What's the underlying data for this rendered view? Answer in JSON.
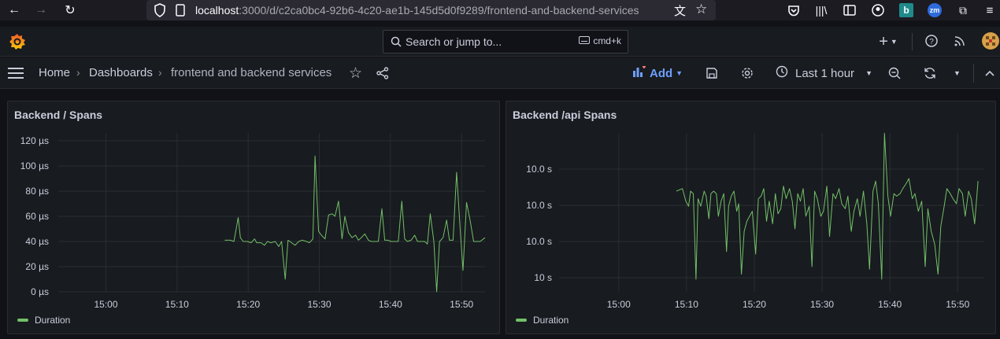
{
  "browser": {
    "url_host": "localhost",
    "url_rest": ":3000/d/c2ca0bc4-92b6-4c20-ae1b-145d5d0f9289/frontend-and-backend-services"
  },
  "topnav": {
    "search_placeholder": "Search or jump to...",
    "shortcut": "cmd+k",
    "add_label": "+"
  },
  "breadcrumb": {
    "home": "Home",
    "dashboards": "Dashboards",
    "current": "frontend and backend services"
  },
  "toolbar": {
    "add_label": "Add",
    "time_range": "Last 1 hour"
  },
  "colors": {
    "series": "#73bf69",
    "accent": "#6e9fff"
  },
  "chart_data": [
    {
      "type": "line",
      "title": "Backend / Spans",
      "xlabel": "",
      "ylabel": "",
      "y_ticks": [
        "0 µs",
        "20 µs",
        "40 µs",
        "60 µs",
        "80 µs",
        "100 µs",
        "120 µs"
      ],
      "ylim": [
        0,
        120
      ],
      "x_ticks": [
        "15:00",
        "15:10",
        "15:20",
        "15:30",
        "15:40",
        "15:50"
      ],
      "xlim_minutes": [
        53.3,
        113.3
      ],
      "legend": "bottom-left",
      "series": [
        {
          "name": "Duration",
          "x_minutes": [
            76.7,
            77.5,
            78.0,
            78.6,
            78.9,
            79.3,
            79.9,
            80.4,
            80.9,
            81.2,
            81.8,
            82.3,
            82.7,
            83.2,
            83.8,
            84.3,
            84.7,
            85.2,
            85.6,
            86.1,
            86.6,
            87.1,
            87.6,
            88.2,
            88.6,
            89.1,
            89.4,
            89.9,
            90.3,
            90.8,
            91.3,
            91.8,
            92.2,
            92.7,
            93.2,
            93.6,
            94.1,
            94.6,
            95.1,
            95.5,
            95.9,
            96.4,
            96.9,
            97.3,
            97.9,
            98.3,
            98.8,
            99.2,
            99.6,
            100.1,
            100.6,
            101.1,
            101.6,
            102.0,
            102.4,
            102.9,
            103.4,
            103.8,
            104.3,
            104.8,
            105.2,
            105.6,
            106.1,
            106.5,
            106.9,
            107.4,
            107.9,
            108.3,
            108.8,
            109.3,
            109.8,
            110.2,
            110.7,
            111.2,
            111.7,
            112.1,
            112.6,
            113.3
          ],
          "values": [
            41,
            41,
            40,
            59,
            43,
            40,
            40,
            39,
            42,
            39,
            39,
            37,
            40,
            39,
            40,
            36,
            40,
            10,
            41,
            39,
            37,
            40,
            41,
            40,
            39,
            42,
            108,
            48,
            45,
            42,
            61,
            62,
            60,
            72,
            42,
            60,
            47,
            43,
            45,
            41,
            43,
            46,
            41,
            40,
            40,
            40,
            66,
            41,
            41,
            40,
            40,
            40,
            72,
            42,
            40,
            41,
            45,
            40,
            40,
            40,
            38,
            62,
            40,
            0,
            40,
            43,
            57,
            41,
            41,
            95,
            50,
            17,
            71,
            57,
            40,
            40,
            40,
            43
          ]
        }
      ]
    },
    {
      "type": "line",
      "title": "Backend /api Spans",
      "xlabel": "",
      "ylabel": "",
      "y_ticks": [
        "10 s",
        "10.0 s",
        "10.0 s",
        "10.0 s"
      ],
      "ylim": [
        0,
        3
      ],
      "x_ticks": [
        "15:00",
        "15:10",
        "15:20",
        "15:30",
        "15:40",
        "15:50"
      ],
      "xlim_minutes": [
        51.2,
        113.8
      ],
      "legend": "bottom-left",
      "series": [
        {
          "name": "Duration",
          "x_minutes": [
            68.5,
            69.4,
            69.9,
            70.3,
            70.6,
            71.0,
            71.4,
            71.7,
            72.1,
            72.6,
            72.9,
            73.3,
            73.6,
            74.0,
            74.4,
            74.7,
            75.1,
            75.5,
            75.9,
            76.2,
            76.6,
            77.0,
            77.4,
            77.7,
            78.1,
            78.5,
            78.9,
            79.3,
            79.7,
            80.2,
            80.6,
            81.0,
            81.4,
            81.8,
            82.2,
            82.7,
            83.1,
            83.5,
            83.9,
            84.3,
            84.7,
            85.2,
            85.6,
            86.0,
            86.4,
            86.8,
            87.2,
            87.6,
            88.1,
            88.5,
            88.9,
            89.3,
            89.8,
            90.2,
            90.7,
            91.1,
            91.6,
            92.0,
            92.5,
            92.9,
            93.4,
            93.8,
            94.3,
            94.7,
            95.2,
            95.6,
            96.1,
            96.6,
            97.0,
            97.5,
            97.9,
            98.3,
            98.8,
            99.2,
            99.7,
            100.1,
            100.6,
            101.0,
            101.5,
            101.9,
            102.4,
            102.8,
            103.3,
            103.7,
            104.2,
            104.7,
            105.2,
            105.6,
            106.1,
            106.6,
            107.1,
            107.5,
            108.0,
            108.4,
            108.9,
            109.3,
            109.8,
            110.2,
            110.7,
            111.1,
            111.6,
            112.0,
            112.5,
            113.0
          ],
          "values": [
            2.0,
            2.05,
            1.8,
            1.7,
            2.0,
            1.95,
            0.25,
            1.85,
            1.7,
            2.0,
            1.9,
            1.45,
            1.95,
            2.0,
            1.95,
            1.5,
            1.8,
            1.95,
            0.8,
            1.7,
            1.9,
            2.0,
            1.6,
            1.75,
            0.35,
            1.2,
            1.4,
            1.5,
            1.6,
            0.75,
            1.85,
            1.9,
            2.05,
            1.4,
            1.8,
            1.35,
            1.95,
            1.55,
            1.65,
            2.1,
            1.85,
            2.05,
            1.8,
            1.25,
            1.95,
            1.8,
            2.05,
            1.5,
            1.7,
            0.5,
            2.0,
            1.85,
            1.5,
            1.6,
            2.1,
            1.1,
            1.95,
            1.85,
            2.05,
            1.75,
            1.65,
            1.9,
            1.2,
            1.6,
            1.85,
            1.5,
            2.0,
            1.35,
            0.45,
            2.0,
            2.2,
            1.75,
            0.25,
            3.15,
            1.9,
            1.5,
            1.95,
            1.9,
            1.95,
            2.05,
            2.15,
            2.25,
            1.85,
            1.95,
            1.6,
            1.8,
            0.5,
            1.65,
            1.2,
            0.95,
            0.35,
            1.3,
            1.7,
            2.05,
            1.95,
            1.85,
            1.75,
            2.05,
            1.95,
            1.5,
            2.0,
            1.85,
            1.35,
            2.2
          ]
        }
      ]
    }
  ]
}
